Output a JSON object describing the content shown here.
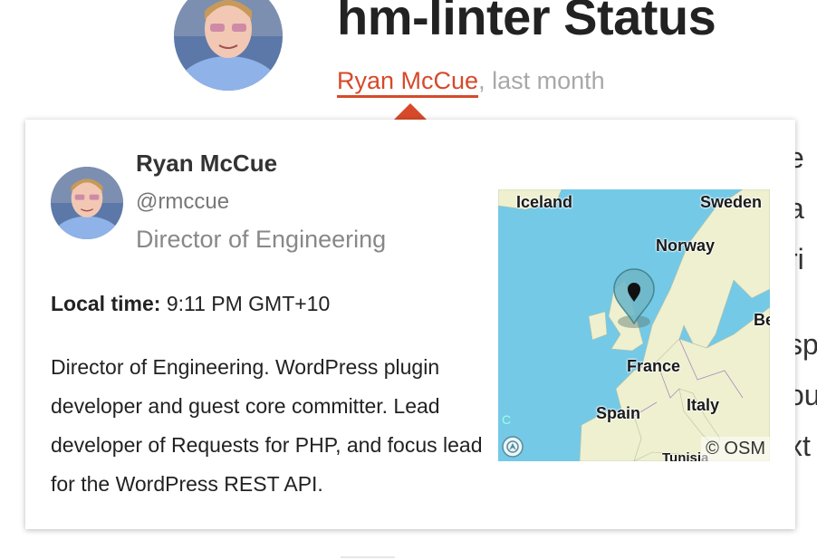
{
  "post": {
    "title": "hm-linter Status",
    "author": "Ryan McCue",
    "meta_separator": ",",
    "date": "last month"
  },
  "background_fragments": [
    "e",
    "a",
    "ri",
    "sp",
    "ou",
    "xt"
  ],
  "popover": {
    "name": "Ryan McCue",
    "handle": "@rmccue",
    "role": "Director of Engineering",
    "local_time_label": "Local time:",
    "local_time_value": "9:11 PM GMT+10",
    "bio": "Director of Engineering. WordPress plugin developer and guest core committer. Lead developer of Requests for PHP, and focus lead for the WordPress REST API."
  },
  "map": {
    "labels": {
      "iceland": "Iceland",
      "sweden": "Sweden",
      "norway": "Norway",
      "be": "Be",
      "france": "France",
      "spain": "Spain",
      "italy": "Italy",
      "tunisia": "Tunisia",
      "c": "C"
    },
    "attribution": "© OSM",
    "colors": {
      "sea": "#74c9e6",
      "land": "#eef0d0",
      "pin": "#6fb8c8",
      "accent": "#d64a2a"
    }
  }
}
